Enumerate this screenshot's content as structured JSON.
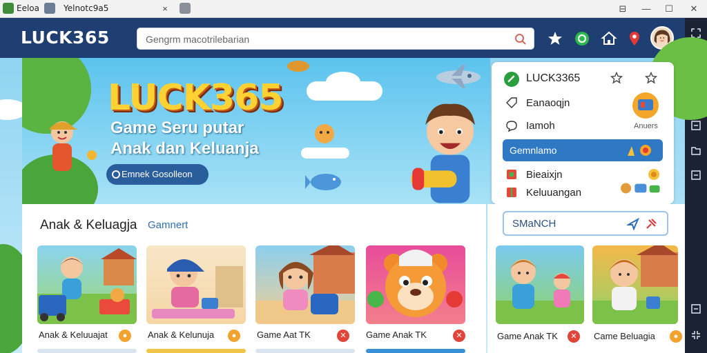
{
  "titlebar": {
    "app_name": "Eeloa",
    "tab_title": "Yelnotc9a5",
    "close_tab": "×",
    "window_controls": [
      "⊟",
      "—",
      "☐",
      "✕"
    ]
  },
  "header": {
    "logo": "LUCK365",
    "search_placeholder": "Gengrm macotrilebarian"
  },
  "banner": {
    "title": "LUCK365",
    "subtitle_line1": "Game Seru putar",
    "subtitle_line2": "Anak dan Keluanja",
    "button_label": "Emnek Gosolleon"
  },
  "sidecard": {
    "title": "LUCK3365",
    "item1": "Eanaoqjn",
    "item2": "Iamoh",
    "item2_badge": "Anuers",
    "active_item": "Gemnlamo",
    "item4": "Bieaixjn",
    "item5": "Keluuangan"
  },
  "content": {
    "section_title": "Anak & Keluagja",
    "section_tab": "Gamnert",
    "tiles": [
      {
        "label": "Anak & Keluuajat"
      },
      {
        "label": "Anak & Kelunuja"
      },
      {
        "label": "Game Aat TK"
      },
      {
        "label": "Game Anak TK"
      }
    ]
  },
  "rpanel": {
    "search_label": "SMaNCH",
    "tiles": [
      {
        "label": "Game Anak TK"
      },
      {
        "label": "Came Beluagia"
      }
    ]
  },
  "colors": {
    "header_bg": "#1f3f72",
    "accent_blue": "#2f78c4",
    "logo_yellow": "#ffd233",
    "rail_bg": "#1b2233"
  }
}
